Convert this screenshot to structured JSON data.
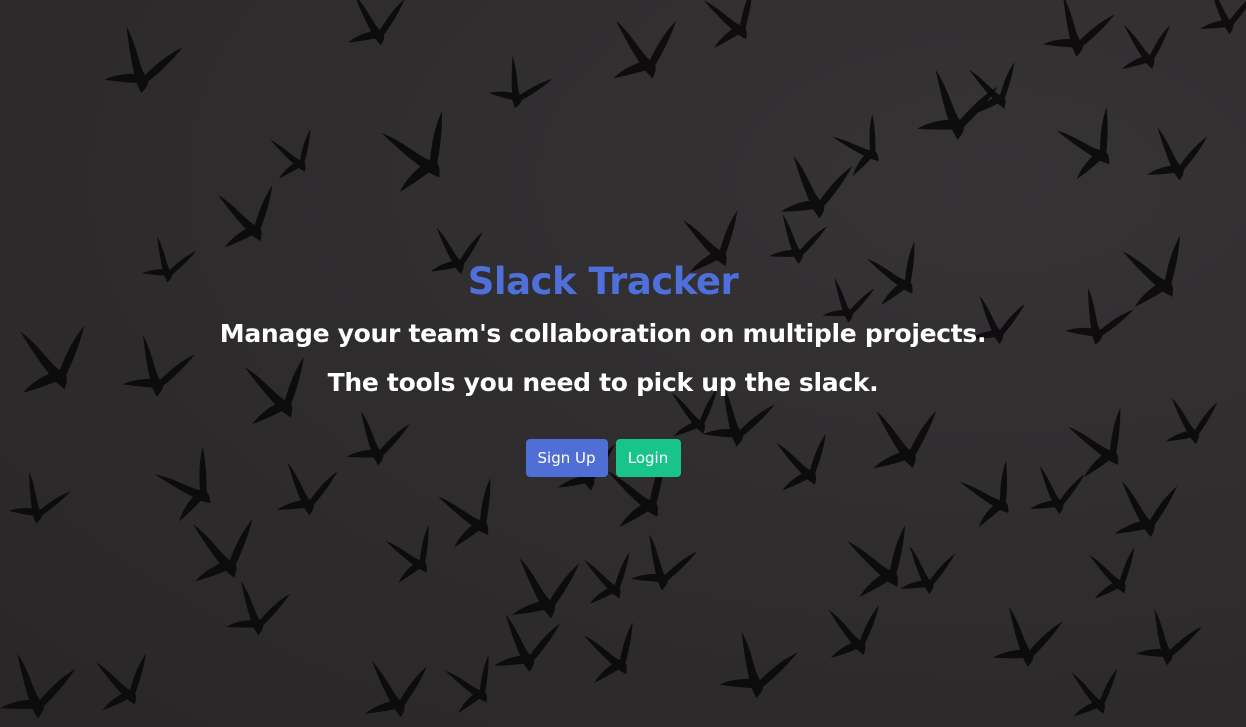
{
  "hero": {
    "title": "Slack Tracker",
    "subtitle_1": "Manage your team's collaboration on multiple projects.",
    "subtitle_2": "The tools you need to pick up the slack."
  },
  "actions": {
    "signup_label": "Sign Up",
    "login_label": "Login"
  },
  "colors": {
    "title": "#4f6fda",
    "signup": "#4f6fd7",
    "login": "#19c48a",
    "background": "#2e2c2c"
  },
  "background": {
    "image": "flock-of-birds-silhouette"
  }
}
